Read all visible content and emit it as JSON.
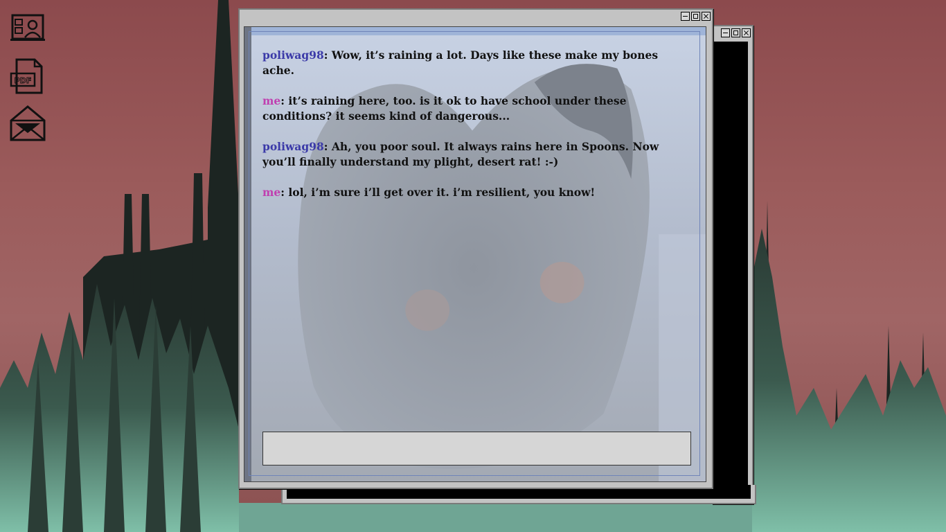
{
  "desktop": {
    "icons": [
      {
        "name": "contacts",
        "icon": "contact-card-icon"
      },
      {
        "name": "pdf",
        "icon": "pdf-file-icon",
        "label": "PDF"
      },
      {
        "name": "mail",
        "icon": "envelope-icon"
      }
    ]
  },
  "chat_window": {
    "controls": [
      "minimize",
      "maximize",
      "close"
    ],
    "messages": [
      {
        "sender": "poliwag98",
        "separator": ":",
        "text": " Wow, it’s raining a lot. Days like these make my bones ache."
      },
      {
        "sender": "me",
        "separator": ":",
        "text": " it’s raining here, too. is it ok to have school under these conditions? it seems kind of dangerous..."
      },
      {
        "sender": "poliwag98",
        "separator": ":",
        "text": " Ah, you poor soul. It always rains here in Spoons. Now you’ll finally understand my plight, desert rat! :-)"
      },
      {
        "sender": "me",
        "separator": ":",
        "text": " lol, i’m sure i’ll get over it. i’m resilient, you know!"
      }
    ],
    "input": {
      "value": "",
      "placeholder": ""
    }
  },
  "back_window": {
    "controls": [
      "minimize",
      "maximize",
      "close"
    ]
  },
  "colors": {
    "sky": "#9b5b5b",
    "spires": "#7fbfa8",
    "window_chrome": "#c3c3c3",
    "sender_them": "#3b3aa8",
    "sender_me": "#c040b0",
    "input_bg": "#d6d6d6"
  }
}
